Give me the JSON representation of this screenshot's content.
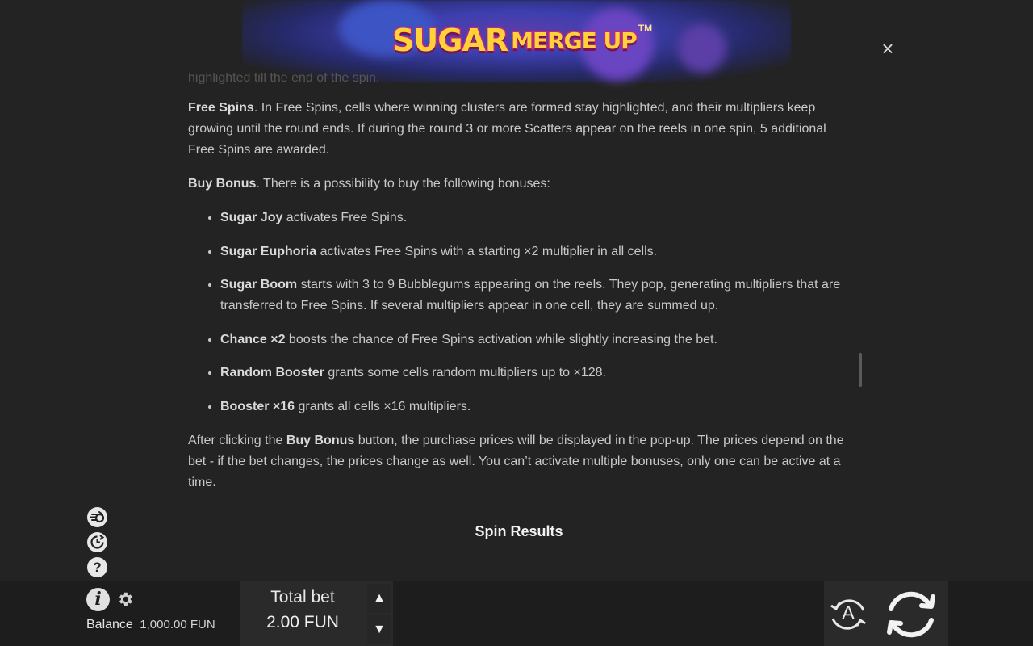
{
  "header": {
    "logo_text_main": "SUGAR",
    "logo_text_sub": "MERGE UP",
    "logo_tm": "TM",
    "close_label": "×"
  },
  "rules": {
    "faded_line": "highlighted till the end of the spin.",
    "free_spins": {
      "title": "Free Spins",
      "text": ". In Free Spins, cells where winning clusters are formed stay highlighted, and their multipliers keep growing until the round ends. If during the round 3 or more Scatters appear on the reels in one spin, 5 additional Free Spins are awarded."
    },
    "buy_bonus": {
      "title": "Buy Bonus",
      "text": ". There is a possibility to buy the following bonuses:"
    },
    "bonuses": [
      {
        "name": "Sugar Joy",
        "text": " activates Free Spins."
      },
      {
        "name": "Sugar Euphoria",
        "text": " activates Free Spins with a starting ×2 multiplier in all cells."
      },
      {
        "name": "Sugar Boom",
        "text": " starts with 3 to 9 Bubblegums appearing on the reels. They pop, generating multipliers that are transferred to Free Spins. If several multipliers appear in one cell, they are summed up."
      },
      {
        "name": "Chance ×2",
        "text": " boosts the chance of Free Spins activation while slightly increasing the bet."
      },
      {
        "name": "Random Booster",
        "text": " grants some cells random multipliers up to ×128."
      },
      {
        "name": "Booster ×16",
        "text": " grants all cells ×16 multipliers."
      }
    ],
    "after_click": {
      "prefix": "After clicking the ",
      "button_name": "Buy Bonus",
      "suffix": " button, the purchase prices will be displayed in the pop-up. The prices depend on the bet - if the bet changes, the prices change as well. You can’t activate multiple bonuses, only one can be active at a time."
    },
    "spin_results_title": "Spin Results"
  },
  "side_icons": {
    "fast_spin": "ƨ",
    "history": "↺",
    "help": "?"
  },
  "bottom": {
    "info_label": "i",
    "balance_label": "Balance",
    "balance_value": "1,000.00 FUN",
    "total_bet_label": "Total bet",
    "total_bet_value": "2.00 FUN",
    "bet_up": "▲",
    "bet_down": "▼",
    "autoplay_label": "A"
  },
  "colors": {
    "background": "#232323",
    "text": "#c9c9c9",
    "logo_fill": "#ffd23a",
    "logo_stroke": "#c1267e"
  }
}
